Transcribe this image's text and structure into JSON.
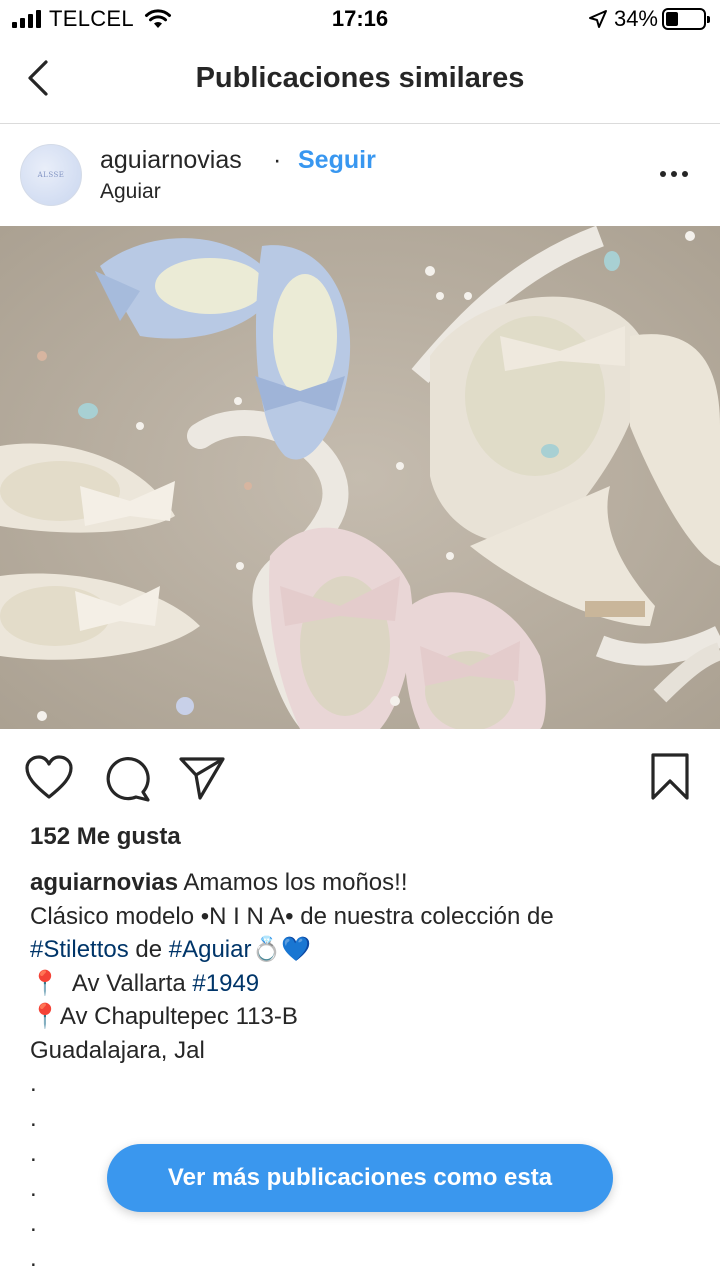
{
  "status_bar": {
    "carrier": "TELCEL",
    "time": "17:16",
    "battery": "34%",
    "battery_level": 0.34
  },
  "nav": {
    "title": "Publicaciones similares"
  },
  "post": {
    "username": "aguiarnovias",
    "separator": "·",
    "follow_label": "Seguir",
    "location": "Aguiar",
    "avatar_text": "ALSSE",
    "likes": "152 Me gusta",
    "caption": {
      "username": "aguiarnovias",
      "line1_text": "Amamos los moños!!",
      "line2": "Clásico modelo •N I N A• de nuestra colección de",
      "line3_tag1": "#Stilettos",
      "line3_mid": " de ",
      "line3_tag2": "#Aguiar",
      "line3_emoji": "💍💙",
      "line4_pin": "📍",
      "line4_text": "  Av Vallarta ",
      "line4_tag": "#1949",
      "line5_pin": "📍",
      "line5_text": "Av Chapultepec 113-B",
      "line6": "Guadalajara, Jal",
      "dots": [
        ".",
        ".",
        ".",
        ".",
        ".",
        "."
      ]
    }
  },
  "icons": {
    "back": "chevron-left-icon",
    "more": "more-horizontal-icon",
    "like": "heart-icon",
    "comment": "comment-bubble-icon",
    "share": "paper-plane-icon",
    "save": "bookmark-icon"
  },
  "cta": {
    "label": "Ver más publicaciones como esta"
  },
  "colors": {
    "accent": "#3897f0",
    "cta": "#3a97ee",
    "hashtag": "#003569"
  }
}
